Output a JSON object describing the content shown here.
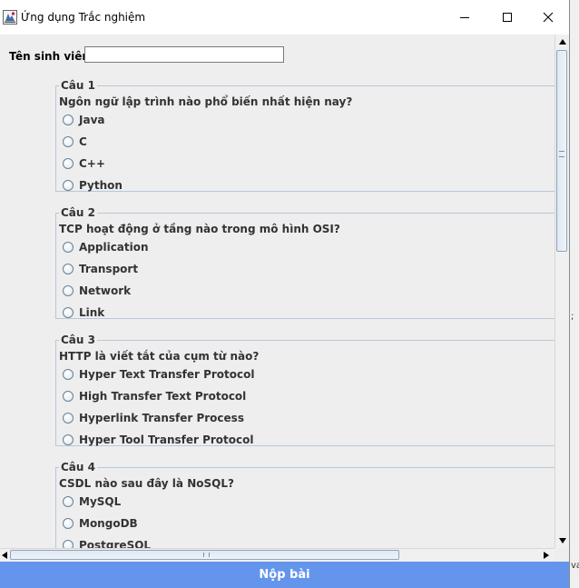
{
  "window": {
    "title": "Ứng dụng Trắc nghiệm",
    "icon": "java-app-icon",
    "controls": [
      "minimize-icon",
      "maximize-icon",
      "close-icon"
    ]
  },
  "student": {
    "label": "Tên sinh viên:",
    "value": ""
  },
  "questions": [
    {
      "number": "Câu 1",
      "text": "Ngôn ngữ lập trình nào phổ biến nhất hiện nay?",
      "options": [
        "Java",
        "C",
        "C++",
        "Python"
      ]
    },
    {
      "number": "Câu 2",
      "text": "TCP hoạt động ở tầng nào trong mô hình OSI?",
      "options": [
        "Application",
        "Transport",
        "Network",
        "Link"
      ]
    },
    {
      "number": "Câu 3",
      "text": "HTTP là viết tắt của cụm từ nào?",
      "options": [
        "Hyper Text Transfer Protocol",
        "High Transfer Text Protocol",
        "Hyperlink Transfer Process",
        "Hyper Tool Transfer Protocol"
      ]
    },
    {
      "number": "Câu 4",
      "text": "CSDL nào sau đây là NoSQL?",
      "options": [
        "MySQL",
        "MongoDB",
        "PostgreSQL",
        ""
      ]
    }
  ],
  "submit": {
    "label": "Nộp bài",
    "color": "#6495ed"
  },
  "background_fragments": {
    "right_mark_1": ";",
    "right_mark_2": "va"
  }
}
